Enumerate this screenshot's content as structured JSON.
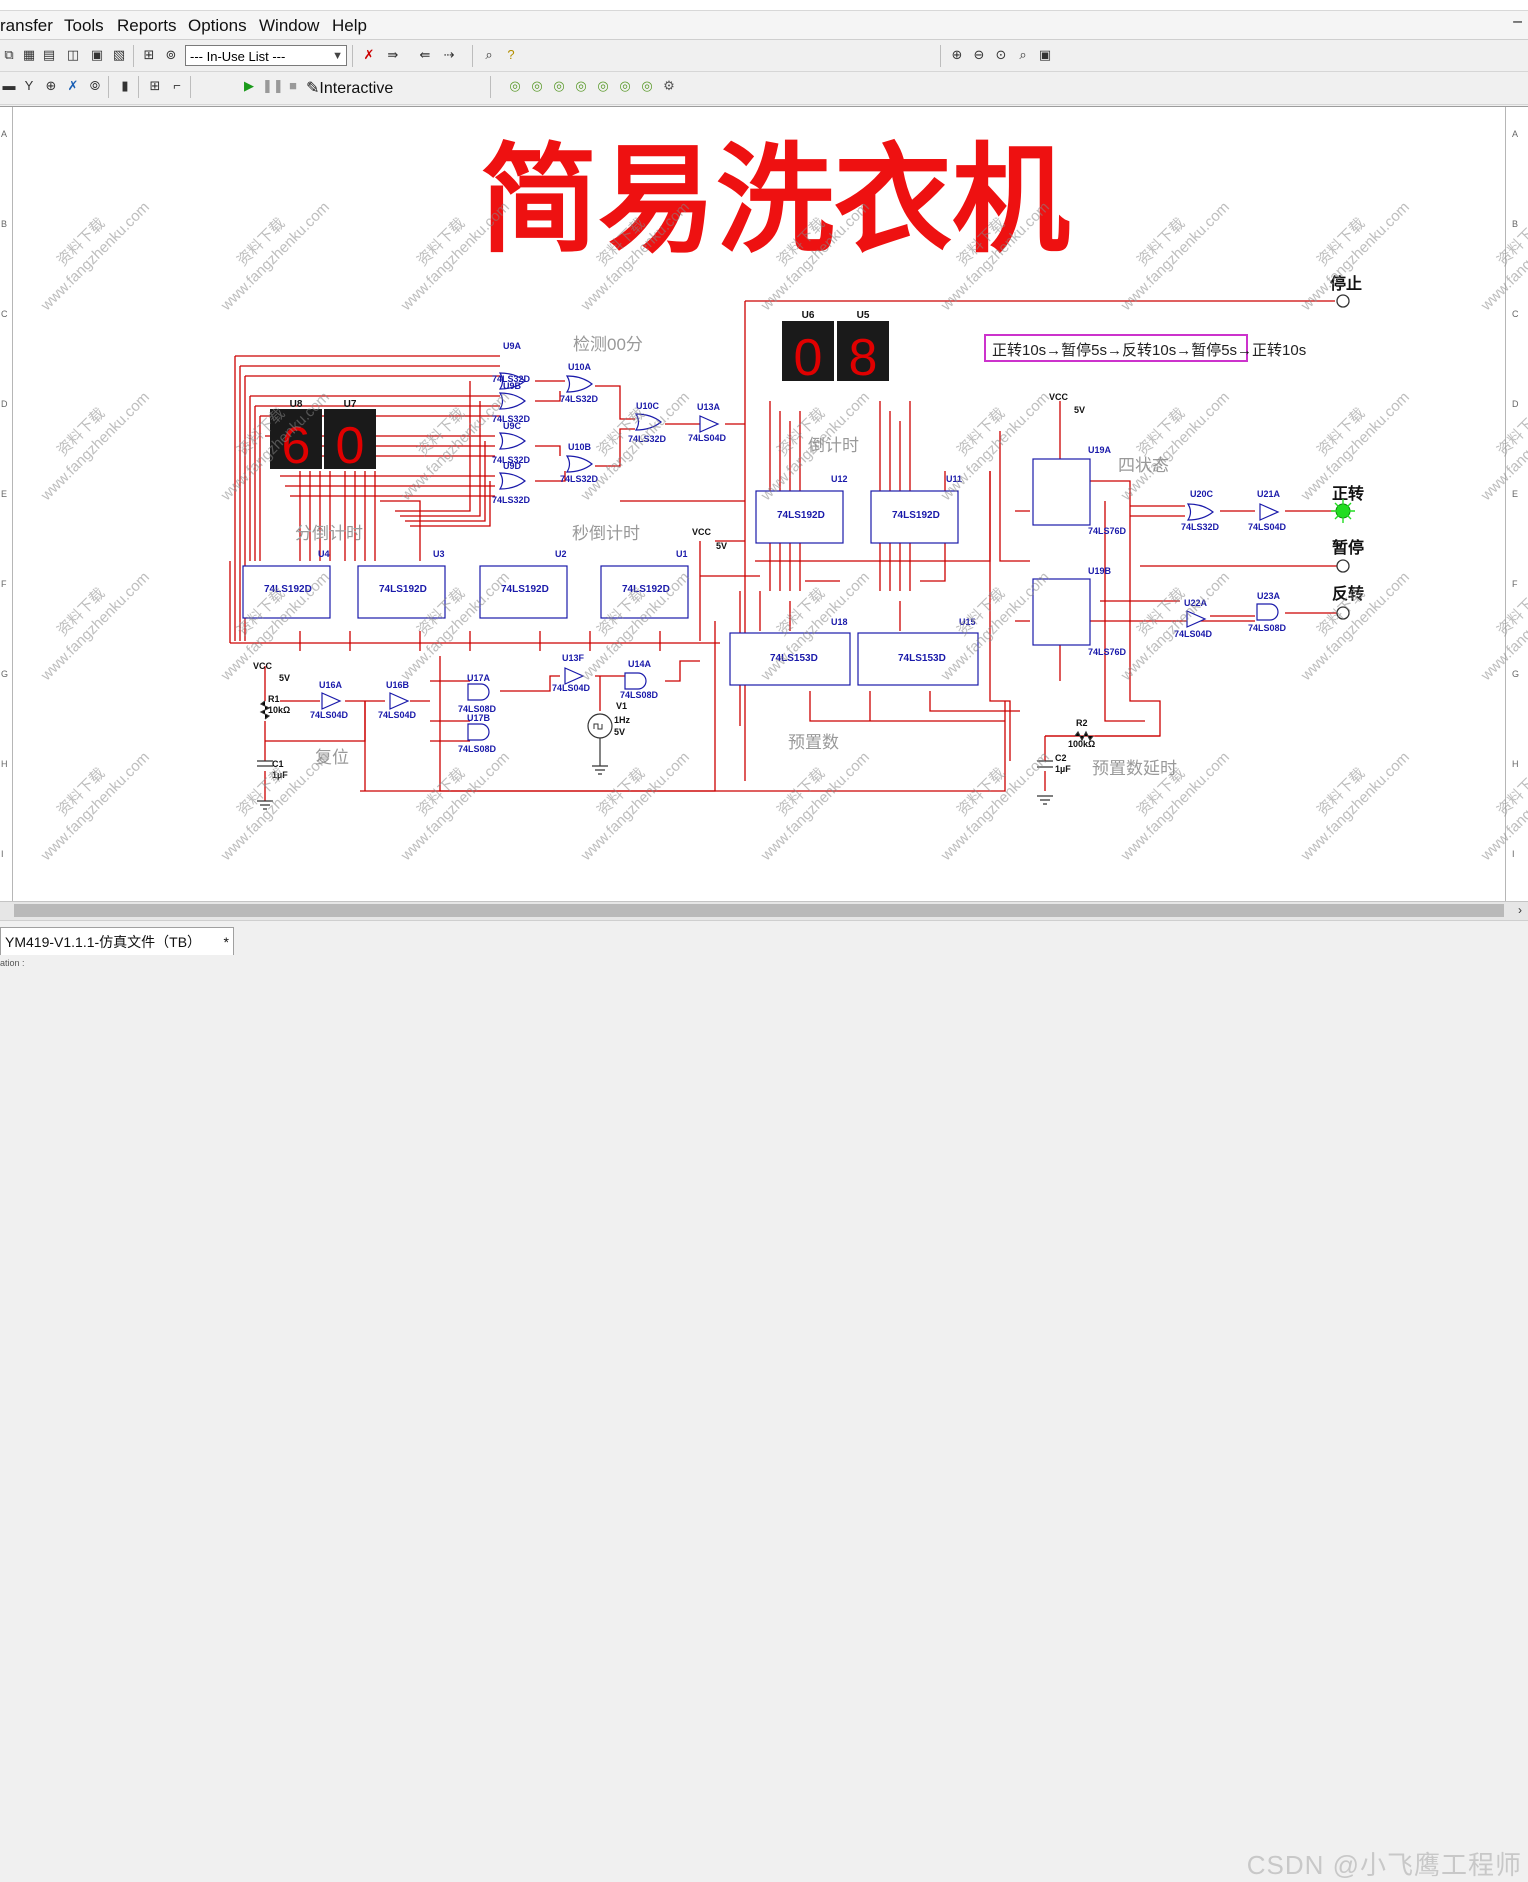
{
  "menu": {
    "items": [
      "ransfer",
      "Tools",
      "Reports",
      "Options",
      "Window",
      "Help"
    ],
    "minimize_glyph": "–"
  },
  "toolbar": {
    "inuse_list": "--- In-Use List ---",
    "interactive_label": "Interactive"
  },
  "schematic": {
    "title": "简易洗衣机",
    "sequence_note": "正转10s→暂停5s→反转10s→暂停5s→正转10s",
    "section_labels": {
      "detect": "检测00分",
      "min_countdown": "分倒计时",
      "sec_countdown": "秒倒计时",
      "countdown": "倒计时",
      "four_states": "四状态",
      "preset": "预置数",
      "preset_delay": "预置数延时",
      "reset": "复位"
    },
    "outputs": {
      "stop": "停止",
      "forward": "正转",
      "pause": "暂停",
      "reverse": "反转"
    },
    "displays": {
      "left_labels": [
        "U8",
        "U7"
      ],
      "left_digits": [
        "6",
        "0"
      ],
      "right_labels": [
        "U6",
        "U5"
      ],
      "right_digits": [
        "0",
        "8"
      ]
    },
    "parts": {
      "u9a": "U9A",
      "u9b": "U9B",
      "u9c": "U9C",
      "u9d": "U9D",
      "u10a": "U10A",
      "u10b": "U10B",
      "u10c": "U10C",
      "u13a": "U13A",
      "ls32": "74LS32D",
      "ls04": "74LS04D",
      "ls08": "74LS08D",
      "ls192": "74LS192D",
      "ls153": "74LS153D",
      "ls76": "74LS76D",
      "u12": "U12",
      "u11": "U11",
      "u4": "U4",
      "u3": "U3",
      "u2": "U2",
      "u1": "U1",
      "u18": "U18",
      "u15": "U15",
      "u19a": "U19A",
      "u19b": "U19B",
      "u20c": "U20C",
      "u21a": "U21A",
      "u22a": "U22A",
      "u23a": "U23A",
      "u16a": "U16A",
      "u16b": "U16B",
      "u17a": "U17A",
      "u17b": "U17B",
      "u13f": "U13F",
      "u14a": "U14A",
      "vcc": "VCC",
      "v5": "5V",
      "r1": "R1",
      "r1v": "10kΩ",
      "c1": "C1",
      "c1v": "1µF",
      "r2": "R2",
      "r2v": "100kΩ",
      "c2": "C2",
      "c2v": "1µF",
      "v1": "V1",
      "v1f": "1Hz",
      "v1v": "5V"
    },
    "watermark_a": "资料下载",
    "watermark_b": "www.fangzhenku.com",
    "ruler_left": [
      "A",
      "B",
      "C",
      "D",
      "E",
      "F",
      "G",
      "H",
      "I"
    ]
  },
  "tab": {
    "title": "YM419-V1.1.1-仿真文件（TB）",
    "modified": "*"
  },
  "status": {
    "text": "ation :"
  },
  "csdn": "CSDN @小飞鹰工程师",
  "colors": {
    "wire": "#cc0000",
    "part": "#1a1aaa",
    "title": "#ee1111",
    "led_on": "#22dd22",
    "seq_box": "#cc33cc"
  }
}
